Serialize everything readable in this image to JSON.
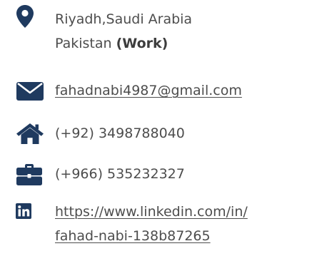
{
  "contact": {
    "accent_color": "#1f3a5f",
    "text_color": "#4d4d4d",
    "address": {
      "icon": "map-pin-icon",
      "line1": "Riyadh,Saudi Arabia",
      "line2_prefix": "Pakistan ",
      "line2_bold": "(Work)"
    },
    "email": {
      "icon": "envelope-icon",
      "value": "fahadnabi4987@gmail.com"
    },
    "home_phone": {
      "icon": "home-icon",
      "value": "(+92) 3498788040"
    },
    "work_phone": {
      "icon": "briefcase-icon",
      "value": "(+966) 535232327"
    },
    "linkedin": {
      "icon": "linkedin-icon",
      "line1": "https://www.linkedin.com/in/",
      "line2": "fahad-nabi-138b87265"
    }
  }
}
